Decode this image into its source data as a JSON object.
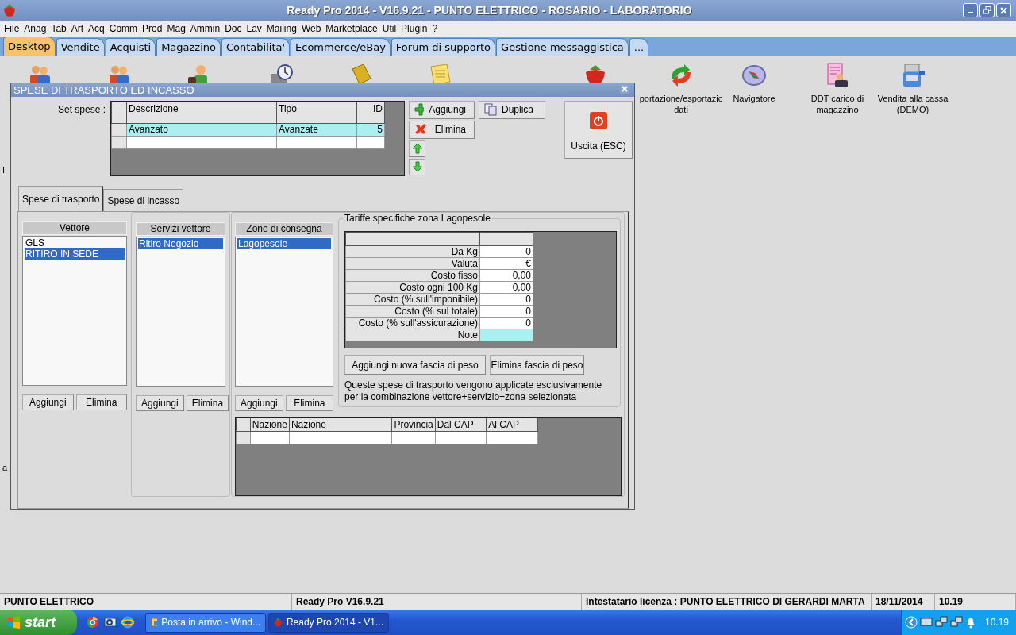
{
  "window": {
    "title": "Ready Pro 2014 - V16.9.21 - PUNTO ELETTRICO - ROSARIO - LABORATORIO"
  },
  "menu": [
    "File",
    "Anag",
    "Tab",
    "Art",
    "Acq",
    "Comm",
    "Prod",
    "Mag",
    "Ammin",
    "Doc",
    "Lav",
    "Mailing",
    "Web",
    "Marketplace",
    "Util",
    "Plugin",
    "?"
  ],
  "tabs": [
    {
      "label": "Desktop",
      "selected": true
    },
    {
      "label": "Vendite",
      "selected": false
    },
    {
      "label": "Acquisti",
      "selected": false
    },
    {
      "label": "Magazzino",
      "selected": false
    },
    {
      "label": "Contabilita'",
      "selected": false
    },
    {
      "label": "Ecommerce/eBay",
      "selected": false
    },
    {
      "label": "Forum di supporto",
      "selected": false
    },
    {
      "label": "Gestione messaggistica",
      "selected": false
    },
    {
      "label": "...",
      "selected": false
    }
  ],
  "desktop_icons": [
    {
      "kind": "people"
    },
    {
      "kind": "people"
    },
    {
      "kind": "worker"
    },
    {
      "kind": "clock"
    },
    {
      "kind": "folder"
    },
    {
      "kind": "note"
    },
    {
      "kind": "strawberry"
    },
    {
      "kind": "arrows",
      "label": "portazione/esportazic dati"
    },
    {
      "kind": "compass",
      "label": "Navigatore"
    },
    {
      "kind": "document",
      "label": "DDT carico di magazzino"
    },
    {
      "kind": "register",
      "label": "Vendita alla cassa (DEMO)"
    }
  ],
  "peek_texts": [
    "I",
    "a"
  ],
  "dialog": {
    "title": "SPESE DI TRASPORTO ED INCASSO",
    "set_label": "Set spese :",
    "set_table": {
      "columns": [
        "Descrizione",
        "Tipo",
        "ID"
      ],
      "rows": [
        {
          "cells": [
            "Avanzato",
            "Avanzate",
            "5"
          ],
          "selected": true
        }
      ]
    },
    "add_button": "Aggiungi",
    "duplicate_button": "Duplica",
    "delete_button": "Elimina",
    "exit_button": "Uscita (ESC)",
    "tabs": [
      {
        "label": "Spese di trasporto",
        "selected": true
      },
      {
        "label": "Spese di incasso",
        "selected": false
      }
    ],
    "lists": [
      {
        "header": "Vettore",
        "items": [
          {
            "label": "GLS",
            "selected": false
          },
          {
            "label": "RITIRO IN SEDE",
            "selected": true
          }
        ],
        "buttons": [
          "Aggiungi",
          "Elimina"
        ]
      },
      {
        "header": "Servizi vettore",
        "items": [
          {
            "label": "Ritiro Negozio",
            "selected": true
          }
        ],
        "buttons": [
          "Aggiungi",
          "Elimina"
        ]
      },
      {
        "header": "Zone di consegna",
        "items": [
          {
            "label": "Lagopesole",
            "selected": true
          }
        ],
        "buttons": [
          "Aggiungi",
          "Elimina"
        ]
      }
    ],
    "tariffe": {
      "title": "Tariffe specifiche zona Lagopesole",
      "rows": [
        {
          "label": "Da Kg",
          "value": "0",
          "selected": false
        },
        {
          "label": "Valuta",
          "value": "€",
          "selected": false
        },
        {
          "label": "Costo fisso",
          "value": "0,00",
          "selected": false
        },
        {
          "label": "Costo ogni 100 Kg",
          "value": "0,00",
          "selected": false
        },
        {
          "label": "Costo (% sull'imponibile)",
          "value": "0",
          "selected": false
        },
        {
          "label": "Costo (% sul totale)",
          "value": "0",
          "selected": false
        },
        {
          "label": "Costo (% sull'assicurazione)",
          "value": "0",
          "selected": false
        },
        {
          "label": "Note",
          "selected": true
        }
      ],
      "buttons": [
        "Aggiungi nuova fascia di peso",
        "Elimina fascia di peso"
      ],
      "note": "Queste spese di trasporto vengono applicate esclusivamente per la combinazione vettore+servizio+zona selezionata"
    },
    "nation_table": {
      "columns": [
        "Nazione",
        "Nazione",
        "Provincia",
        "Dal CAP",
        "Al CAP"
      ]
    }
  },
  "status_bar": [
    "PUNTO ELETTRICO",
    "Ready Pro V16.9.21",
    "Intestatario licenza : PUNTO ELETTRICO DI GERARDI MARTA",
    "18/11/2014",
    "10.19"
  ],
  "taskbar": {
    "start": "start",
    "tasks": [
      {
        "label": "Posta in arrivo - Wind...",
        "selected": false
      },
      {
        "label": "Ready Pro 2014 - V1...",
        "selected": true
      }
    ],
    "clock": "10.19"
  }
}
